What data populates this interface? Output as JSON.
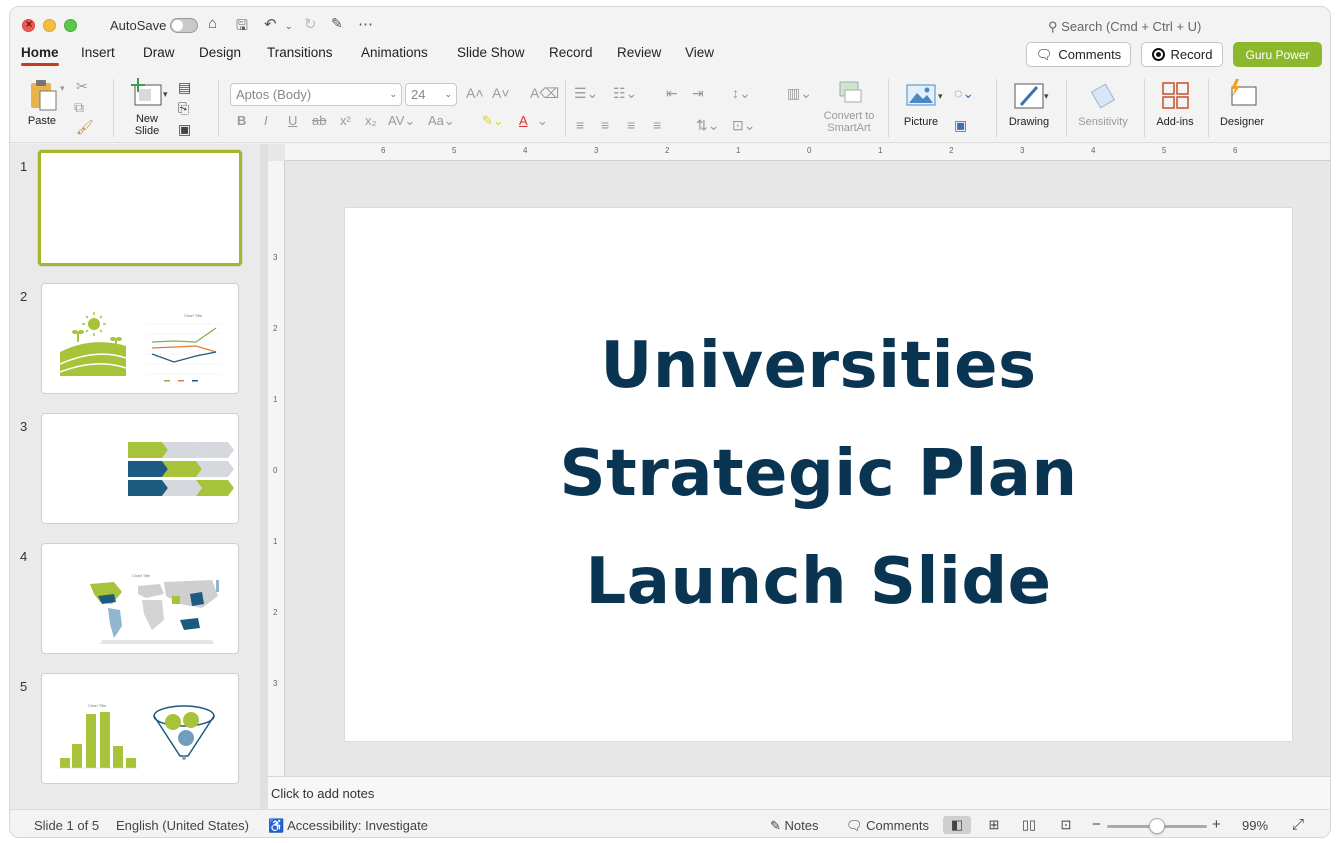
{
  "window": {
    "autosave_label": "AutoSave",
    "search_placeholder": "Search (Cmd + Ctrl + U)"
  },
  "tabs": [
    "Home",
    "Insert",
    "Draw",
    "Design",
    "Transitions",
    "Animations",
    "Slide Show",
    "Record",
    "Review",
    "View"
  ],
  "header_buttons": {
    "comments": "Comments",
    "record": "Record",
    "guru": "Guru Power"
  },
  "ribbon": {
    "paste": "Paste",
    "new_slide_line1": "New",
    "new_slide_line2": "Slide",
    "font_name": "Aptos (Body)",
    "font_size": "24",
    "convert_line1": "Convert to",
    "convert_line2": "SmartArt",
    "picture": "Picture",
    "drawing": "Drawing",
    "sensitivity": "Sensitivity",
    "addins": "Add-ins",
    "designer": "Designer"
  },
  "thumbnails": [
    {
      "number": "1"
    },
    {
      "number": "2",
      "chart_title": "Chart Title"
    },
    {
      "number": "3"
    },
    {
      "number": "4",
      "chart_title": "Chart Title"
    },
    {
      "number": "5",
      "chart_title": "Chart Title"
    }
  ],
  "slide": {
    "title_line1": "Universities",
    "title_line2": "Strategic Plan",
    "title_line3": "Launch Slide",
    "title_color": "#0a3552"
  },
  "ruler": {
    "h_labels": [
      "6",
      "5",
      "4",
      "3",
      "2",
      "1",
      "0",
      "1",
      "2",
      "3",
      "4",
      "5",
      "6"
    ],
    "v_labels": [
      "3",
      "2",
      "1",
      "0",
      "1",
      "2",
      "3"
    ]
  },
  "notes_placeholder": "Click to add notes",
  "status": {
    "slide_count": "Slide 1 of 5",
    "language": "English (United States)",
    "accessibility": "Accessibility: Investigate",
    "notes": "Notes",
    "comments": "Comments",
    "zoom": "99%"
  },
  "colors": {
    "accent_green": "#8db82c",
    "tab_underline": "#c43e1c",
    "slide_blue": "#1c5a80"
  }
}
